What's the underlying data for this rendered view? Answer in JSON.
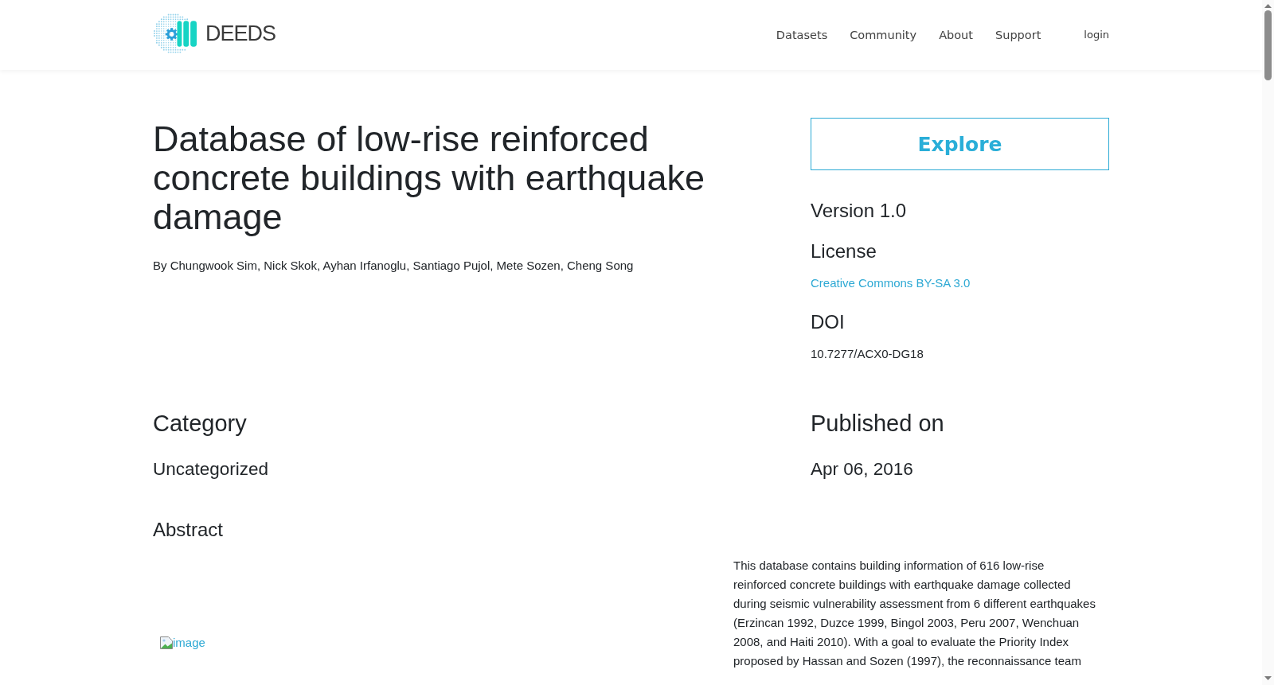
{
  "header": {
    "brand": "DEEDS",
    "nav": [
      "Datasets",
      "Community",
      "About",
      "Support"
    ],
    "login": "login"
  },
  "dataset": {
    "title": "Database of low-rise reinforced concrete buildings with earthquake damage",
    "authors": "By Chungwook Sim, Nick Skok, Ayhan Irfanoglu, Santiago Pujol, Mete Sozen, Cheng Song"
  },
  "sidebar": {
    "explore_button": "Explore",
    "version": "Version 1.0",
    "license": {
      "heading": "License",
      "link": "Creative Commons BY-SA 3.0"
    },
    "doi": {
      "heading": "DOI",
      "value": "10.7277/ACX0-DG18"
    }
  },
  "category": {
    "heading": "Category",
    "value": "Uncategorized"
  },
  "published": {
    "heading": "Published on",
    "value": "Apr 06, 2016"
  },
  "abstract": {
    "heading": "Abstract",
    "image_alt": "image",
    "text": "This database contains building information of 616 low-rise reinforced concrete buildings with earthquake damage collected during seismic vulnerability assessment from 6 different earthquakes (Erzincan 1992, Duzce 1999, Bingol 2003, Peru 2007, Wenchuan 2008, and Haiti 2010). With a goal to evaluate the Priority Index proposed by Hassan and Sozen (1997), the reconnaissance team"
  }
}
